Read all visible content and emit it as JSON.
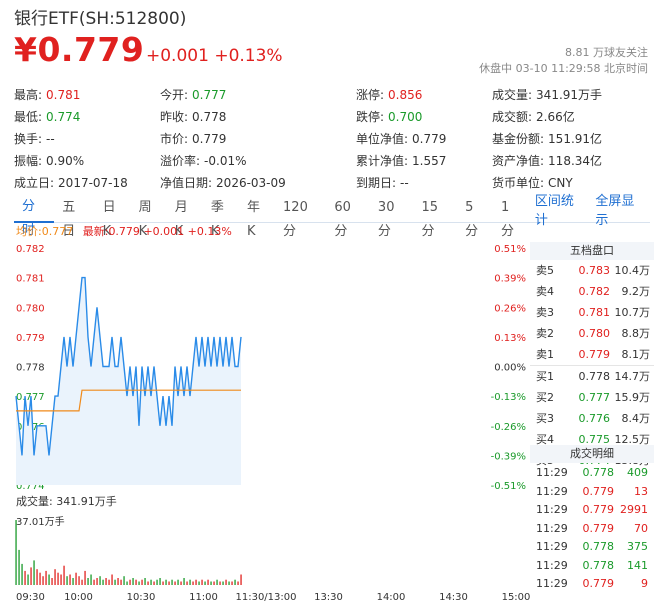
{
  "header": {
    "title": "银行ETF(SH:512800)",
    "price": "¥0.779",
    "change": "+0.001",
    "change_pct": "+0.13%",
    "followers": "8.81 万球友关注",
    "status": "休盘中 03-10 11:29:58 北京时间"
  },
  "stats": [
    [
      [
        "最高:",
        "0.781",
        "red"
      ],
      [
        "今开:",
        "0.777",
        "green"
      ],
      [
        "涨停:",
        "0.856",
        "red"
      ],
      [
        "成交量:",
        "341.91万手",
        ""
      ]
    ],
    [
      [
        "最低:",
        "0.774",
        "green"
      ],
      [
        "昨收:",
        "0.778",
        ""
      ],
      [
        "跌停:",
        "0.700",
        "green"
      ],
      [
        "成交额:",
        "2.66亿",
        ""
      ]
    ],
    [
      [
        "换手:",
        "--",
        ""
      ],
      [
        "市价:",
        "0.779",
        ""
      ],
      [
        "单位净值:",
        "0.779",
        ""
      ],
      [
        "基金份额:",
        "151.91亿",
        ""
      ]
    ],
    [
      [
        "振幅:",
        "0.90%",
        ""
      ],
      [
        "溢价率:",
        "-0.01%",
        ""
      ],
      [
        "累计净值:",
        "1.557",
        ""
      ],
      [
        "资产净值:",
        "118.34亿",
        ""
      ]
    ],
    [
      [
        "成立日:",
        "2017-07-18",
        ""
      ],
      [
        "净值日期:",
        "2026-03-09",
        ""
      ],
      [
        "到期日:",
        "--",
        ""
      ],
      [
        "货币单位:",
        "CNY",
        ""
      ]
    ]
  ],
  "tabs": [
    "分时",
    "五日",
    "日K",
    "周K",
    "月K",
    "季K",
    "年K",
    "120分",
    "60分",
    "30分",
    "15分",
    "5分",
    "1分"
  ],
  "tabs_right": [
    "区间统计",
    "全屏显示"
  ],
  "legend": {
    "avg_label": "均价:",
    "avg": "0.777",
    "latest_label": "最新:",
    "latest": "0.779",
    "latest_change": "+0.001",
    "latest_pct": "+0.13%"
  },
  "chart_data": {
    "type": "line",
    "y_ticks": [
      "0.782",
      "0.781",
      "0.780",
      "0.779",
      "0.778",
      "0.777",
      "0.776",
      "0.775",
      "0.774"
    ],
    "pct_ticks": [
      "0.51%",
      "0.39%",
      "0.26%",
      "0.13%",
      "0.00%",
      "-0.13%",
      "-0.26%",
      "-0.39%",
      "-0.51%"
    ],
    "ylim": [
      0.774,
      0.782
    ],
    "x_ticks": [
      "09:30",
      "10:00",
      "10:30",
      "11:00",
      "11:30/13:00",
      "13:30",
      "14:00",
      "14:30",
      "15:00"
    ],
    "series": [
      {
        "values": [
          0.777,
          0.776,
          0.775,
          0.777,
          0.776,
          0.777,
          0.775,
          0.776,
          0.776,
          0.776,
          0.776,
          0.775,
          0.776,
          0.777,
          0.777,
          0.778,
          0.779,
          0.778,
          0.779,
          0.778,
          0.779,
          0.78,
          0.781,
          0.781,
          0.779,
          0.778,
          0.779,
          0.78,
          0.779,
          0.778,
          0.778,
          0.778,
          0.779,
          0.778,
          0.778,
          0.779,
          0.778,
          0.777,
          0.778,
          0.777,
          0.778,
          0.776,
          0.778,
          0.777,
          0.778,
          0.777,
          0.778,
          0.777,
          0.776,
          0.777,
          0.776,
          0.777,
          0.776,
          0.778,
          0.777,
          0.778,
          0.777,
          0.778,
          0.777,
          0.778,
          0.779,
          0.778,
          0.779,
          0.778,
          0.779,
          0.778,
          0.779,
          0.778,
          0.779,
          0.778,
          0.779,
          0.778,
          0.779,
          0.778,
          0.778,
          0.779
        ]
      },
      {
        "values": [
          0.7765,
          0.7765,
          0.7765,
          0.7765,
          0.7765,
          0.7765,
          0.7765,
          0.7765,
          0.7765,
          0.7765,
          0.7765,
          0.7765,
          0.7765,
          0.7765,
          0.7765,
          0.7765,
          0.7765,
          0.7765,
          0.7765,
          0.7765,
          0.7765,
          0.7765,
          0.7772,
          0.7772,
          0.7772,
          0.7772,
          0.7772,
          0.7772,
          0.7772,
          0.7772,
          0.7772,
          0.7772,
          0.7772,
          0.7772,
          0.7772,
          0.7772,
          0.7772,
          0.7772,
          0.7772,
          0.7772,
          0.7772,
          0.7772,
          0.7772,
          0.7772,
          0.7772,
          0.7772,
          0.7772,
          0.7772,
          0.7772,
          0.7772,
          0.7772,
          0.7772,
          0.7772,
          0.7772,
          0.7772,
          0.7772,
          0.7772,
          0.7772,
          0.7772,
          0.7772,
          0.7772,
          0.7772,
          0.7772,
          0.7772,
          0.7772,
          0.7772,
          0.7772,
          0.7772,
          0.7772,
          0.7772,
          0.7772,
          0.7772,
          0.7772,
          0.7772,
          0.7772,
          0.7772
        ]
      }
    ],
    "volume_label": "成交量:",
    "volume_total": "341.91万手",
    "volume_max_label": "37.01万手",
    "volumes": [
      37,
      20,
      12,
      8,
      6,
      10,
      14,
      9,
      7,
      5,
      8,
      6,
      4,
      9,
      7,
      6,
      11,
      5,
      6,
      4,
      7,
      5,
      3,
      8,
      4,
      6,
      3,
      4,
      5,
      3,
      4,
      3,
      6,
      3,
      4,
      3,
      5,
      2,
      3,
      4,
      3,
      2,
      3,
      4,
      2,
      3,
      2,
      3,
      4,
      2,
      3,
      2,
      3,
      2,
      3,
      2,
      4,
      2,
      3,
      2,
      3,
      2,
      3,
      2,
      3,
      2,
      2,
      3,
      2,
      2,
      3,
      2,
      2,
      3,
      2,
      6
    ]
  },
  "orderbook": {
    "title": "五档盘口",
    "rows": [
      [
        "卖5",
        "0.783",
        "10.4万",
        "red"
      ],
      [
        "卖4",
        "0.782",
        "9.2万",
        "red"
      ],
      [
        "卖3",
        "0.781",
        "10.7万",
        "red"
      ],
      [
        "卖2",
        "0.780",
        "8.8万",
        "red"
      ],
      [
        "卖1",
        "0.779",
        "8.1万",
        "red"
      ],
      [
        "买1",
        "0.778",
        "14.7万",
        ""
      ],
      [
        "买2",
        "0.777",
        "15.9万",
        "green"
      ],
      [
        "买3",
        "0.776",
        "8.4万",
        "green"
      ],
      [
        "买4",
        "0.775",
        "12.5万",
        "green"
      ],
      [
        "买5",
        "0.774",
        "15.8万",
        "green"
      ]
    ]
  },
  "trades": {
    "title": "成交明细",
    "rows": [
      [
        "11:29",
        "0.778",
        "409",
        "green"
      ],
      [
        "11:29",
        "0.779",
        "13",
        "red"
      ],
      [
        "11:29",
        "0.779",
        "2991",
        "red"
      ],
      [
        "11:29",
        "0.779",
        "70",
        "red"
      ],
      [
        "11:29",
        "0.778",
        "375",
        "green"
      ],
      [
        "11:29",
        "0.778",
        "141",
        "green"
      ],
      [
        "11:29",
        "0.779",
        "9",
        "red"
      ]
    ]
  },
  "colors": {
    "up": "#e0211f",
    "down": "#1a9a2a",
    "line": "#2a8be8",
    "avg": "#f08a1a",
    "fill": "#eaf3fc"
  }
}
